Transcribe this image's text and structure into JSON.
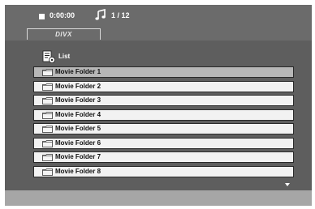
{
  "status": {
    "playback_icon": "stop-icon",
    "time": "0:00:00",
    "track_icon": "music-note-icon",
    "track": "1 / 12"
  },
  "tab": {
    "label": "DIVX"
  },
  "list": {
    "icon": "list-icon",
    "title": "List",
    "items": [
      {
        "label": "Movie Folder 1",
        "icon": "folder-icon",
        "selected": true
      },
      {
        "label": "Movie Folder 2",
        "icon": "folder-icon",
        "selected": false
      },
      {
        "label": "Movie Folder 3",
        "icon": "folder-icon",
        "selected": false
      },
      {
        "label": "Movie Folder 4",
        "icon": "folder-icon",
        "selected": false
      },
      {
        "label": "Movie Folder 5",
        "icon": "folder-icon",
        "selected": false
      },
      {
        "label": "Movie Folder 6",
        "icon": "folder-icon",
        "selected": false
      },
      {
        "label": "Movie Folder 7",
        "icon": "folder-icon",
        "selected": false
      },
      {
        "label": "Movie Folder 8",
        "icon": "folder-icon",
        "selected": false
      }
    ],
    "scroll_icon": "down-arrow-icon"
  },
  "colors": {
    "top_bar": "#6b6b6b",
    "panel": "#5e5e5e",
    "frame": "#a6a6a6",
    "row": "#f2f2f2",
    "row_selected": "#b7b7b7"
  }
}
